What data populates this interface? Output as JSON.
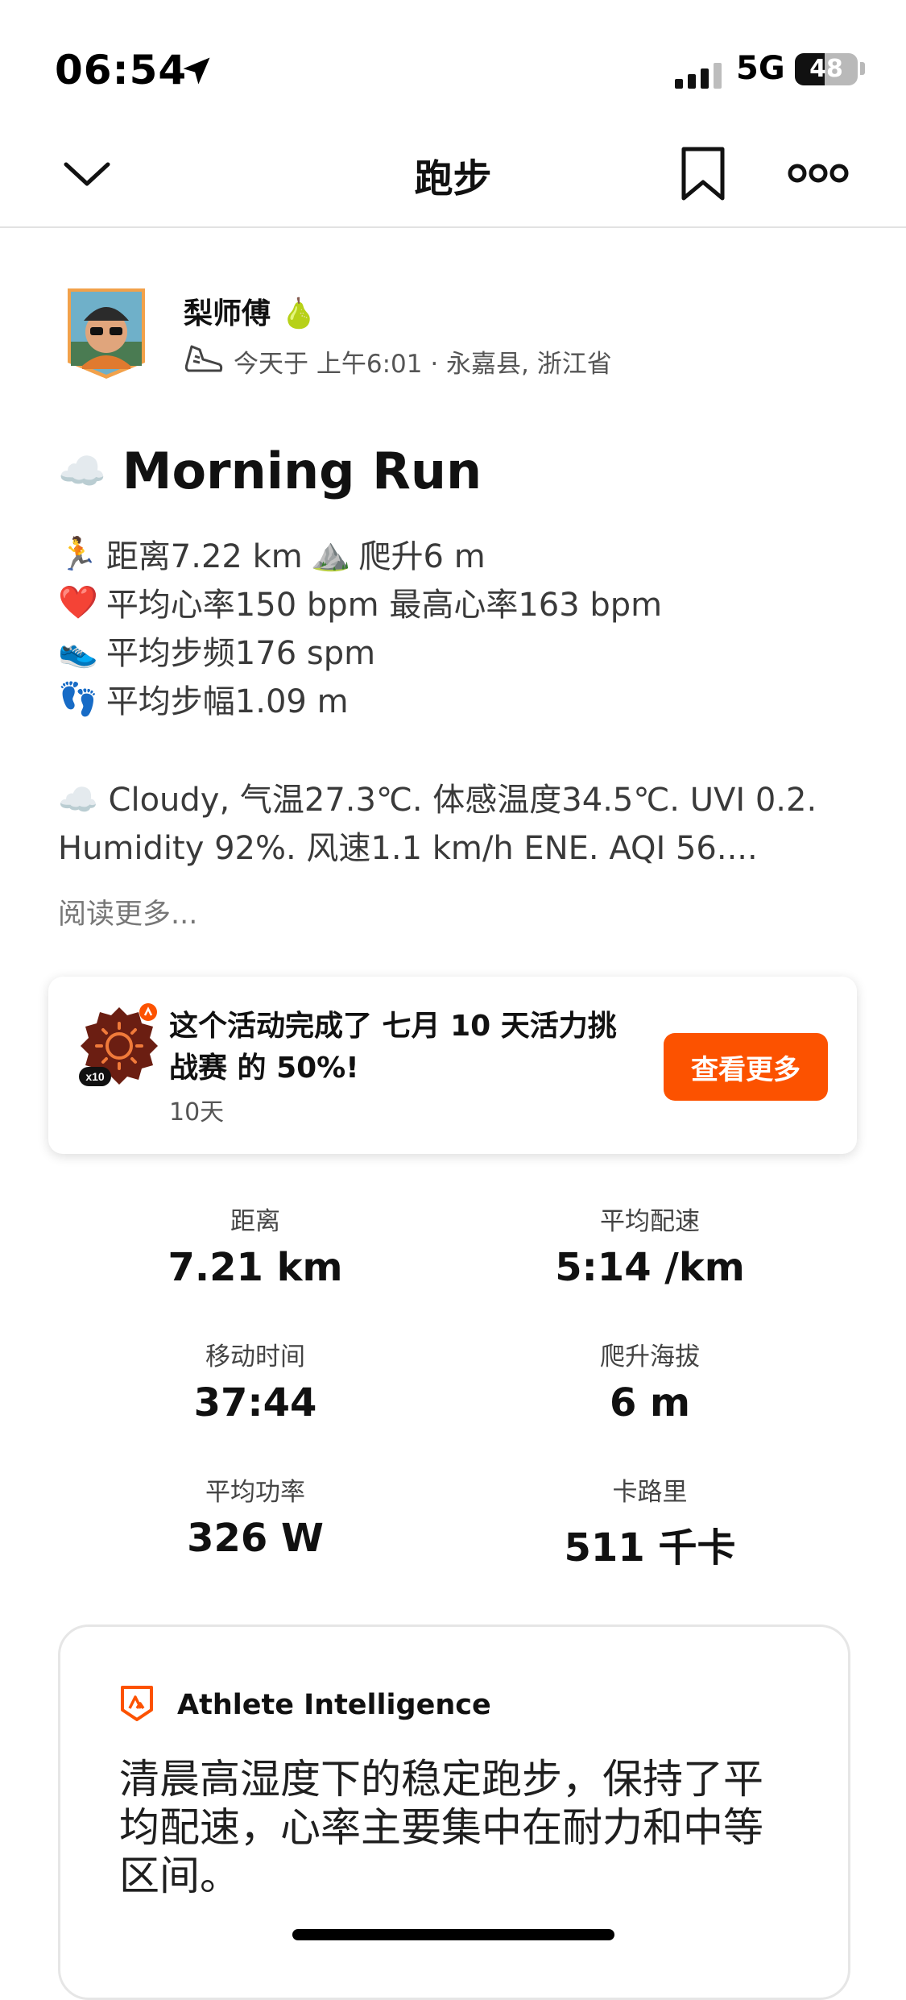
{
  "status": {
    "time": "06:54",
    "network": "5G",
    "battery_level": 48,
    "battery_text": "48"
  },
  "nav": {
    "title": "跑步",
    "back_icon": "chevron-down-icon",
    "bookmark_icon": "bookmark-icon",
    "more_icon": "more-icon"
  },
  "author": {
    "name": "梨师傅 🍐",
    "meta": "今天于 上午6:01 · 永嘉县, 浙江省"
  },
  "activity": {
    "weather_emoji": "☁️",
    "title": "Morning Run"
  },
  "description": {
    "line1_emoji": "🏃",
    "line1a": "距离7.22 km",
    "line1_emoji2": "⛰️",
    "line1b": "爬升6 m",
    "line2_emoji": "❤️",
    "line2": "平均心率150 bpm 最高心率163 bpm",
    "line3_emoji": "👟",
    "line3": "平均步频176 spm",
    "line4_emoji": "👣",
    "line4": "平均步幅1.09 m",
    "weather1": "☁️ Cloudy, 气温27.3℃. 体感温度34.5℃. UVI 0.2.",
    "weather2": "Humidity 92%. 风速1.1 km/h ENE. AQI 56....",
    "read_more": "阅读更多..."
  },
  "challenge": {
    "badge_label": "x10",
    "title": "这个活动完成了 七月 10 天活力挑战赛 的 50%!",
    "subtitle": "10天",
    "button": "查看更多",
    "accent": "#fc5200"
  },
  "stats": [
    {
      "label": "距离",
      "value": "7.21 km"
    },
    {
      "label": "平均配速",
      "value": "5:14 /km"
    },
    {
      "label": "移动时间",
      "value": "37:44"
    },
    {
      "label": "爬升海拔",
      "value": "6 m"
    },
    {
      "label": "平均功率",
      "value": "326 W"
    },
    {
      "label": "卡路里",
      "value": "511 千卡"
    }
  ],
  "ai": {
    "title": "Athlete Intelligence",
    "body": "清晨高湿度下的稳定跑步，保持了平均配速，心率主要集中在耐力和中等区间。"
  }
}
